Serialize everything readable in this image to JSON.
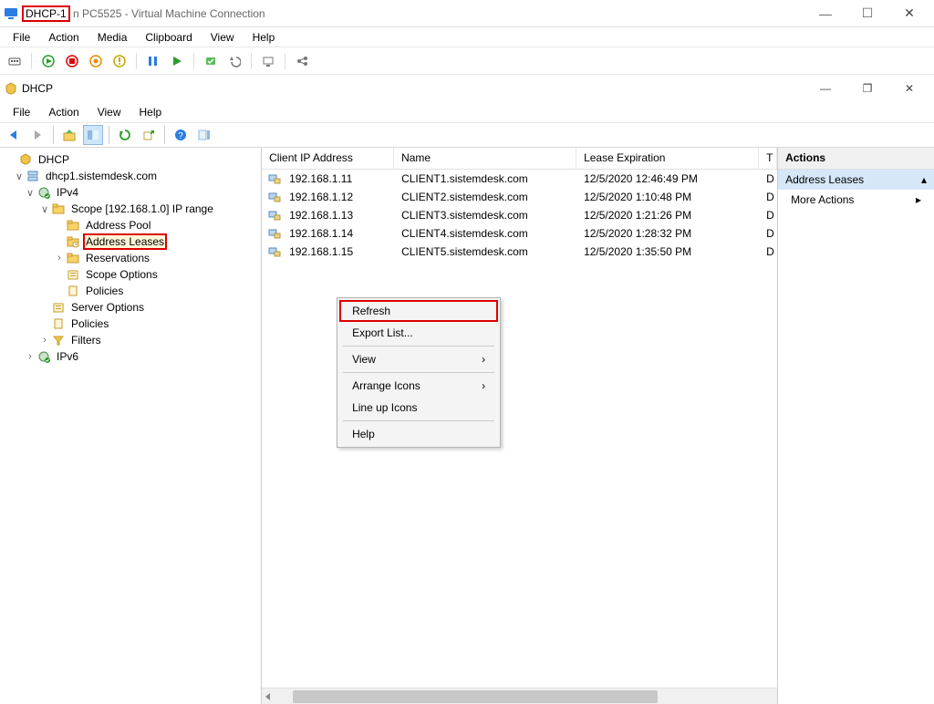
{
  "vm": {
    "name": "DHCP-1",
    "title_suffix": "n PC5525 - Virtual Machine Connection",
    "menu": [
      "File",
      "Action",
      "Media",
      "Clipboard",
      "View",
      "Help"
    ]
  },
  "mmc": {
    "title": "DHCP",
    "menu": [
      "File",
      "Action",
      "View",
      "Help"
    ]
  },
  "tree": {
    "root": "DHCP",
    "server": "dhcp1.sistemdesk.com",
    "ipv4": "IPv4",
    "scope": "Scope [192.168.1.0] IP range",
    "address_pool": "Address Pool",
    "address_leases": "Address Leases",
    "reservations": "Reservations",
    "scope_options": "Scope Options",
    "policies": "Policies",
    "server_options": "Server Options",
    "policies2": "Policies",
    "filters": "Filters",
    "ipv6": "IPv6"
  },
  "list": {
    "columns": {
      "ip": "Client IP Address",
      "name": "Name",
      "lease": "Lease Expiration",
      "type": "T"
    },
    "rows": [
      {
        "ip": "192.168.1.11",
        "name": "CLIENT1.sistemdesk.com",
        "lease": "12/5/2020 12:46:49 PM",
        "type": "D"
      },
      {
        "ip": "192.168.1.12",
        "name": "CLIENT2.sistemdesk.com",
        "lease": "12/5/2020 1:10:48 PM",
        "type": "D"
      },
      {
        "ip": "192.168.1.13",
        "name": "CLIENT3.sistemdesk.com",
        "lease": "12/5/2020 1:21:26 PM",
        "type": "D"
      },
      {
        "ip": "192.168.1.14",
        "name": "CLIENT4.sistemdesk.com",
        "lease": "12/5/2020 1:28:32 PM",
        "type": "D"
      },
      {
        "ip": "192.168.1.15",
        "name": "CLIENT5.sistemdesk.com",
        "lease": "12/5/2020 1:35:50 PM",
        "type": "D"
      }
    ]
  },
  "ctx": {
    "refresh": "Refresh",
    "export": "Export List...",
    "view": "View",
    "arrange": "Arrange Icons",
    "lineup": "Line up Icons",
    "help": "Help"
  },
  "actions": {
    "header": "Actions",
    "group": "Address Leases",
    "more": "More Actions"
  }
}
